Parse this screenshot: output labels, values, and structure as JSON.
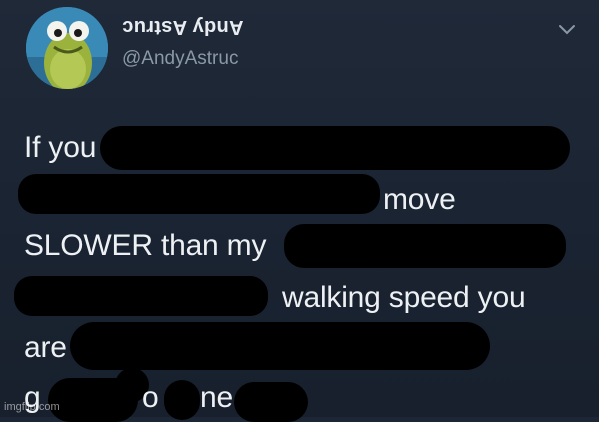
{
  "tweet": {
    "author": {
      "display_name": "Andy Astruc",
      "handle": "@AndyAstruc",
      "avatar_icon": "frog-cartoon-avatar"
    },
    "menu_icon": "chevron-down-icon",
    "lines": [
      "If you",
      "move",
      "SLOWER than my",
      "walking speed you",
      "are",
      "g",
      "o",
      "ne"
    ],
    "redaction_color": "#000000"
  },
  "watermark": "imgflip.com",
  "colors": {
    "background": "#1c2634",
    "text": "#eef1f4",
    "muted": "#8b98a5"
  }
}
